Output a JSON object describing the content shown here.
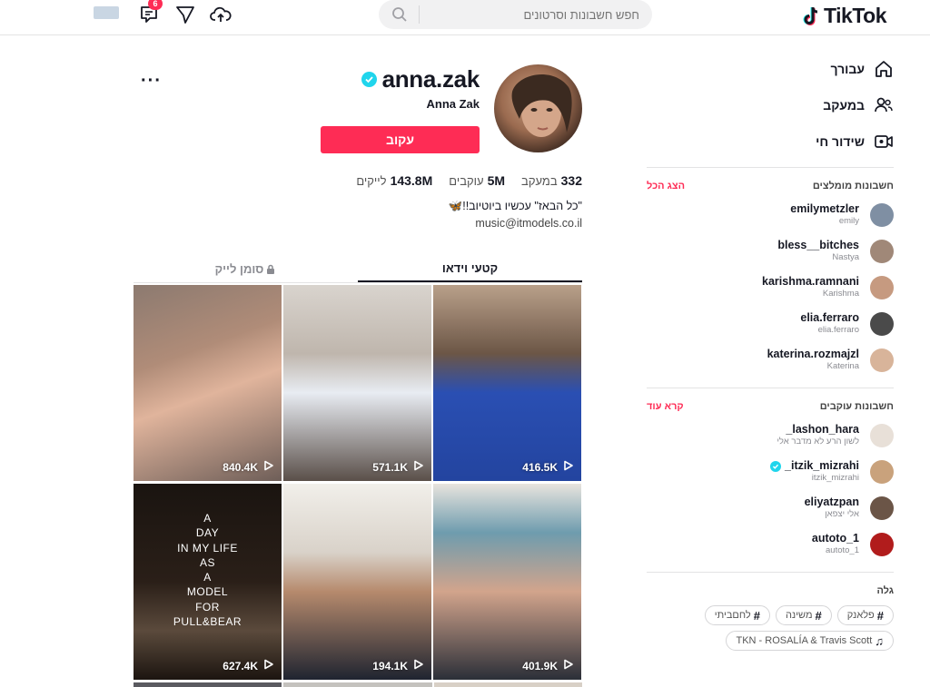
{
  "app": {
    "name": "TikTok",
    "brand_color": "#fe2c55"
  },
  "header": {
    "search_placeholder": "חפש חשבונות וסרטונים",
    "inbox_count": "6"
  },
  "sidebar": {
    "nav": [
      {
        "label": "עבורך",
        "icon": "home-icon"
      },
      {
        "label": "במעקב",
        "icon": "users-icon"
      },
      {
        "label": "שידור חי",
        "icon": "live-video-icon"
      }
    ],
    "suggested": {
      "title": "חשבונות מומלצים",
      "action": "הצג הכל",
      "accounts": [
        {
          "username": "emilymetzler",
          "name": "emily",
          "color": "#7f8fa3",
          "verified": false
        },
        {
          "username": "bless__bitches",
          "name": "Nastya",
          "color": "#a08878",
          "verified": false
        },
        {
          "username": "karishma.ramnani",
          "name": "Karishma",
          "color": "#c69a80",
          "verified": false
        },
        {
          "username": "elia.ferraro",
          "name": "elia.ferraro",
          "color": "#4a4a4a",
          "verified": false
        },
        {
          "username": "katerina.rozmajzl",
          "name": "Katerina",
          "color": "#d8b49a",
          "verified": false
        }
      ]
    },
    "following": {
      "title": "חשבונות עוקבים",
      "action": "קרא עוד",
      "accounts": [
        {
          "username": "lashon_hara_",
          "name": "לשון הרע לא מדבר אלי",
          "color": "#e8e0d8",
          "verified": false
        },
        {
          "username": "itzik_mizrahi_",
          "name": "itzik_mizrahi",
          "color": "#c9a27c",
          "verified": true
        },
        {
          "username": "eliyatzpan",
          "name": "אלי יצפאן",
          "color": "#6b5547",
          "verified": false
        },
        {
          "username": "autoto_1",
          "name": "autoto_1",
          "color": "#b11c1c",
          "verified": false
        }
      ]
    },
    "discover": {
      "title": "גלה",
      "tags": [
        {
          "label": "פלאנק",
          "icon": "hashtag-icon"
        },
        {
          "label": "משינה",
          "icon": "hashtag-icon"
        },
        {
          "label": "לחםביתי",
          "icon": "hashtag-icon"
        },
        {
          "label": "TKN - ROSALÍA & Travis Scott",
          "icon": "music-note-icon"
        }
      ]
    }
  },
  "profile": {
    "username": "anna.zak",
    "display_name": "Anna Zak",
    "follow_label": "עקוב",
    "stats": [
      {
        "value": "332",
        "label": "במעקב"
      },
      {
        "value": "5M",
        "label": "עוקבים"
      },
      {
        "value": "143.8M",
        "label": "לייקים"
      }
    ],
    "bio_line1": "\"כל הבאז\" עכשיו ביוטיוב!!🦋",
    "bio_line2": "music@itmodels.co.il",
    "tabs": {
      "videos": "קטעי וידאו",
      "liked": "סומן לייק"
    }
  },
  "videos": [
    {
      "views": "840.4K",
      "bg": "linear-gradient(160deg,#8c7a70 0%,#b08c78 35%,#e0b49c 55%,#6e5e58 100%)"
    },
    {
      "views": "571.1K",
      "bg": "linear-gradient(180deg,#d9d4ce 0%,#bfb6ad 35%,#e8ecf2 55%,#5a4f49 100%)"
    },
    {
      "views": "416.5K",
      "bg": "linear-gradient(180deg,#b9a08a 0%,#6c5646 35%,#2a4fb3 55%,#23449f 100%)"
    },
    {
      "views": "627.4K",
      "bg": "linear-gradient(180deg,#1a1410 0%,#2a1f18 50%,#5b4a3c 75%,#1c1510 100%)",
      "overlay": "A\nDAY\nIN MY LIFE\nAS\nA\nMODEL\nFOR\nPULL&BEAR"
    },
    {
      "views": "194.1K",
      "bg": "linear-gradient(180deg,#f1efea 0%,#d9d2c9 35%,#b68a6d 55%,#1f2430 100%)"
    },
    {
      "views": "401.9K",
      "bg": "linear-gradient(180deg,#e8e4de 0%,#6e9cae 25%,#d2a48c 55%,#2b2f38 100%)"
    }
  ],
  "third_row_colors": [
    "#5a5a60",
    "#c4c2be",
    "#d8d0c6"
  ]
}
